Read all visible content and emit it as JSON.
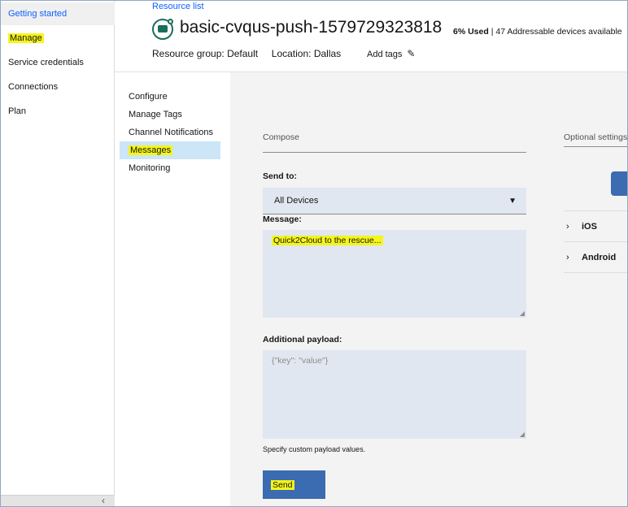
{
  "left_nav": {
    "items": [
      {
        "label": "Getting started"
      },
      {
        "label": "Manage"
      },
      {
        "label": "Service credentials"
      },
      {
        "label": "Connections"
      },
      {
        "label": "Plan"
      }
    ],
    "collapse_icon": "chevron-left-icon"
  },
  "header": {
    "breadcrumb": "Resource list",
    "title": "basic-cvqus-push-1579729323818",
    "usage_percent": "6% Used",
    "usage_separator": "|",
    "usage_devices": "47 Addressable devices available",
    "resource_group_label": "Resource group:",
    "resource_group_value": "Default",
    "location_label": "Location:",
    "location_value": "Dallas",
    "add_tags": "Add tags",
    "add_tags_icon": "pencil-icon"
  },
  "sub_nav": {
    "items": [
      {
        "label": "Configure"
      },
      {
        "label": "Manage Tags"
      },
      {
        "label": "Channel Notifications"
      },
      {
        "label": "Messages"
      },
      {
        "label": "Monitoring"
      }
    ]
  },
  "compose": {
    "section_label": "Compose",
    "send_to_label": "Send to:",
    "send_to_value": "All Devices",
    "message_label": "Message:",
    "message_value": "Quick2Cloud to the rescue...",
    "payload_label": "Additional payload:",
    "payload_placeholder": "{\"key\": \"value\"}",
    "payload_helper": "Specify custom payload values.",
    "send_button": "Send"
  },
  "optional": {
    "section_label": "Optional settings",
    "platforms": [
      {
        "label": "iOS"
      },
      {
        "label": "Android"
      }
    ]
  },
  "colors": {
    "highlight": "#f5f51a",
    "primary_button": "#3b6bb0",
    "link": "#0f62fe",
    "field_bg": "#e1e7f0"
  }
}
